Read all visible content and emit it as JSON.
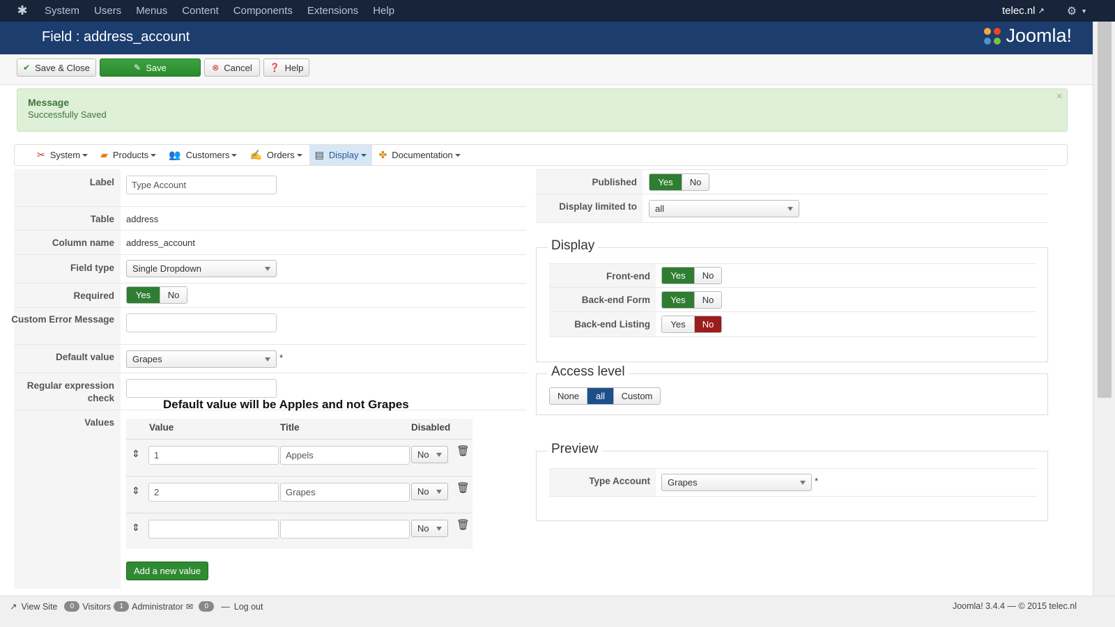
{
  "topnav": {
    "menu": [
      "System",
      "Users",
      "Menus",
      "Content",
      "Components",
      "Extensions",
      "Help"
    ],
    "site": "telec.nl"
  },
  "header": {
    "title": "Field : address_account",
    "logo": "Joomla!"
  },
  "toolbar": {
    "save_close": "Save & Close",
    "save": "Save",
    "cancel": "Cancel",
    "help": "Help"
  },
  "message": {
    "heading": "Message",
    "text": "Successfully Saved"
  },
  "submenu": [
    "System",
    "Products",
    "Customers",
    "Orders",
    "Display",
    "Documentation"
  ],
  "form": {
    "label": {
      "label": "Label",
      "value": "Type Account"
    },
    "table": {
      "label": "Table",
      "value": "address"
    },
    "column": {
      "label": "Column name",
      "value": "address_account"
    },
    "fieldtype": {
      "label": "Field type",
      "value": "Single Dropdown"
    },
    "required": {
      "label": "Required",
      "yes": "Yes",
      "no": "No"
    },
    "custom_error": {
      "label": "Custom Error Message"
    },
    "default_value": {
      "label": "Default value",
      "value": "Grapes",
      "star": "*"
    },
    "regex": {
      "label": "Regular expression check"
    },
    "values": {
      "label": "Values",
      "col_value": "Value",
      "col_title": "Title",
      "col_disabled": "Disabled",
      "rows": [
        {
          "value": "1",
          "title": "Appels",
          "disabled": "No"
        },
        {
          "value": "2",
          "title": "Grapes",
          "disabled": "No"
        },
        {
          "value": "",
          "title": "",
          "disabled": "No"
        }
      ],
      "add": "Add a new value"
    }
  },
  "annotation": "Default value will be Apples and not Grapes",
  "right": {
    "published": {
      "label": "Published",
      "yes": "Yes",
      "no": "No"
    },
    "display_limited": {
      "label": "Display limited to",
      "value": "all"
    },
    "display": {
      "legend": "Display",
      "frontend": {
        "label": "Front-end",
        "yes": "Yes",
        "no": "No"
      },
      "backend_form": {
        "label": "Back-end Form",
        "yes": "Yes",
        "no": "No"
      },
      "backend_listing": {
        "label": "Back-end Listing",
        "yes": "Yes",
        "no": "No"
      }
    },
    "access": {
      "legend": "Access level",
      "none": "None",
      "all": "all",
      "custom": "Custom"
    },
    "preview": {
      "legend": "Preview",
      "label": "Type Account",
      "value": "Grapes",
      "star": "*"
    }
  },
  "footer": {
    "view_site": "View Site",
    "visitors_count": "0",
    "visitors": "Visitors",
    "admin_count": "1",
    "admin": "Administrator",
    "msg_count": "0",
    "logout": "Log out",
    "right": "Joomla! 3.4.4 — © 2015 telec.nl"
  }
}
